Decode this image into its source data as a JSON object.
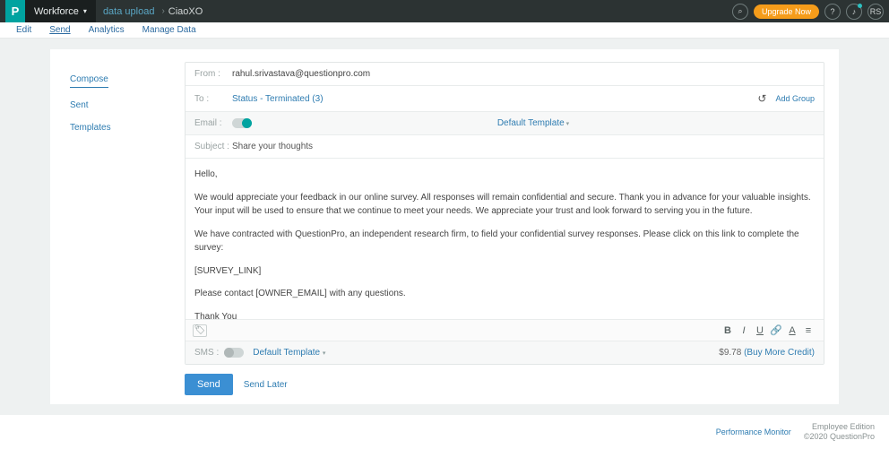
{
  "topbar": {
    "logo": "P",
    "product": "Workforce",
    "breadcrumb_parent": "data upload",
    "breadcrumb_current": "CiaoXO",
    "upgrade": "Upgrade Now",
    "search_icon": "⌕",
    "help_icon": "?",
    "bell_icon": "🔔",
    "avatar": "RS"
  },
  "subnav": {
    "items": [
      "Edit",
      "Send",
      "Analytics",
      "Manage Data"
    ],
    "active": "Send"
  },
  "side": {
    "items": [
      "Compose",
      "Sent",
      "Templates"
    ],
    "active": "Compose"
  },
  "compose": {
    "from_label": "From :",
    "from_value": "rahul.srivastava@questionpro.com",
    "to_label": "To :",
    "to_value": "Status - Terminated (3)",
    "reset_icon": "↺",
    "add_group": "Add Group",
    "email_label": "Email :",
    "template_dropdown": "Default Template",
    "subject_label": "Subject :",
    "subject_value": "Share your thoughts",
    "body": {
      "greeting": "Hello,",
      "p1": "We would appreciate your feedback in our online survey.  All responses will remain confidential and secure.  Thank you in advance for your valuable insights.  Your input will be used to ensure that we continue to meet your needs. We appreciate your trust and look forward to serving you in the future.",
      "p2": "We have contracted with QuestionPro, an independent research firm, to field your confidential survey responses.  Please click on this link to complete the survey:",
      "link": "[SURVEY_LINK]",
      "p3": "Please contact [OWNER_EMAIL] with any questions.",
      "signoff": "Thank You"
    },
    "toolbar": {
      "tag_icon": "🏷",
      "bold": "B",
      "italic": "I",
      "underline": "U",
      "link": "🔗",
      "color": "A",
      "more": "⋯"
    },
    "sms": {
      "label": "SMS :",
      "template": "Default Template",
      "credit_amount": "$9.78",
      "buy_more": "(Buy More Credit)"
    },
    "actions": {
      "send": "Send",
      "send_later": "Send Later"
    }
  },
  "footer": {
    "perf": "Performance Monitor",
    "edition": "Employee Edition",
    "copy": "©2020 QuestionPro"
  }
}
